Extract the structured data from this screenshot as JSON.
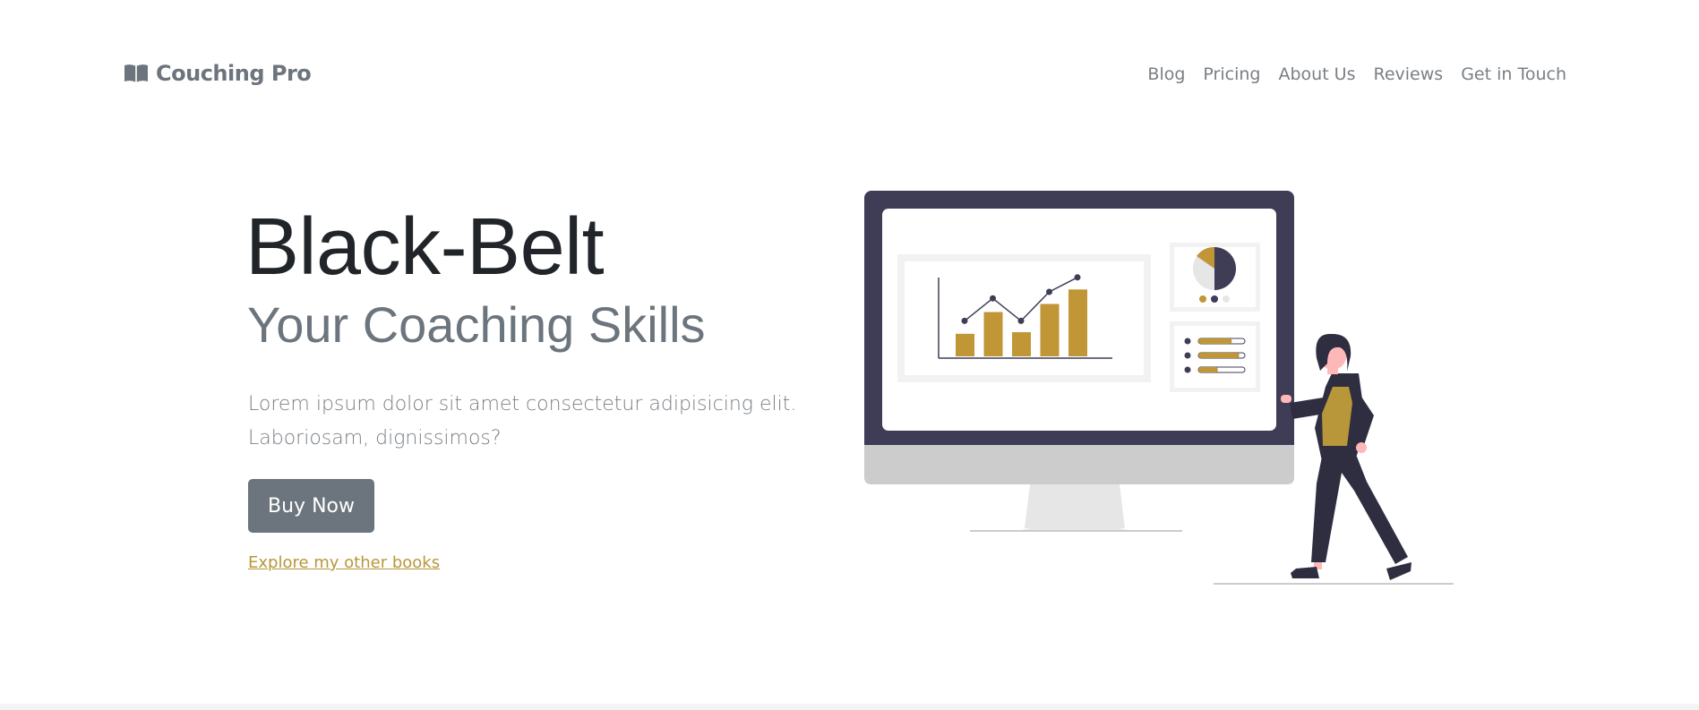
{
  "header": {
    "brand_name": "Couching Pro",
    "brand_icon": "book-icon",
    "nav": [
      {
        "label": "Blog"
      },
      {
        "label": "Pricing"
      },
      {
        "label": "About Us"
      },
      {
        "label": "Reviews"
      },
      {
        "label": "Get in Touch"
      }
    ]
  },
  "hero": {
    "title": "Black-Belt",
    "subtitle": "Your Coaching Skills",
    "description": "Lorem ipsum dolor sit amet consectetur adipisicing elit. Laboriosam, dignissimos?",
    "buy_label": "Buy Now",
    "explore_label": "Explore my other books"
  },
  "illustration": {
    "name": "presentation-illustration",
    "bar_values": [
      0.28,
      0.55,
      0.3,
      0.65,
      0.83
    ],
    "trend_values": [
      0.44,
      0.72,
      0.44,
      0.8,
      0.98
    ],
    "progress_values": [
      0.72,
      0.88,
      0.42
    ]
  },
  "colors": {
    "accent": "#c09637",
    "dark": "#3f3d56",
    "muted": "#6c757d",
    "link": "#b8973a"
  }
}
